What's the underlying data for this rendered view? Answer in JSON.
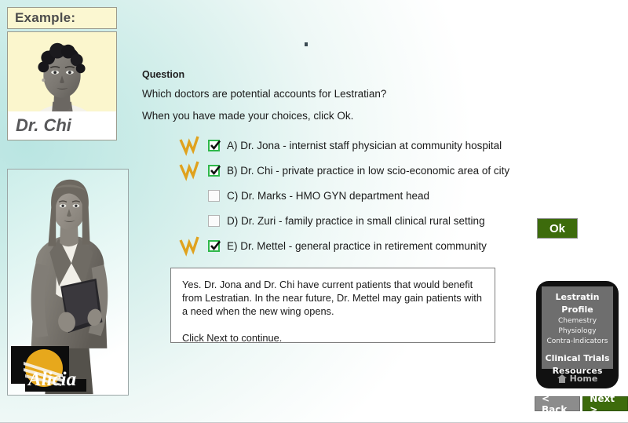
{
  "example_panel": {
    "header_label": "Example:",
    "character_name": "Dr. Chi"
  },
  "alicia_panel": {
    "logo_label": "Alicia"
  },
  "question": {
    "heading": "Question",
    "prompt": "Which doctors are potential accounts for Lestratian?",
    "instruction": "When you have made your choices, click Ok."
  },
  "options": [
    {
      "label": "A) Dr. Jona - internist staff physician at community hospital",
      "checked": true,
      "marked": true
    },
    {
      "label": "B) Dr. Chi - private practice in low scio-economic area of city",
      "checked": true,
      "marked": true
    },
    {
      "label": "C) Dr. Marks - HMO GYN department head",
      "checked": false,
      "marked": false
    },
    {
      "label": "D) Dr. Zuri - family practice in small clinical rural setting",
      "checked": false,
      "marked": false
    },
    {
      "label": "E) Dr. Mettel - general practice in retirement community",
      "checked": true,
      "marked": true
    }
  ],
  "ok_button": {
    "label": "Ok"
  },
  "feedback": {
    "paragraph1": "Yes. Dr. Jona and Dr. Chi have current patients that would benefit from Lestratian. In the near future, Dr. Mettel may gain patients with a need when the new wing opens.",
    "paragraph2": "Click Next to continue."
  },
  "device_menu": {
    "items": [
      {
        "label": "Lestratin Profile",
        "level": "main"
      },
      {
        "label": "Chemestry",
        "level": "sub"
      },
      {
        "label": "Physiology",
        "level": "sub"
      },
      {
        "label": "Contra-Indicators",
        "level": "sub"
      },
      {
        "label": "Clinical Trials",
        "level": "main"
      },
      {
        "label": "Resources",
        "level": "main"
      }
    ],
    "home_label": "Home",
    "home_icon": "home-icon"
  },
  "nav": {
    "back_label": "< Back",
    "next_label": "Next >"
  },
  "colors": {
    "accent_green": "#3d6b0c",
    "checkbox_green": "#2fb84a",
    "tick_gold": "#e0a21e",
    "example_yellow": "#fbf6cd",
    "device_dark": "#111111",
    "device_screen": "#6e6e6e",
    "background_teal": "#b9e5e2"
  }
}
